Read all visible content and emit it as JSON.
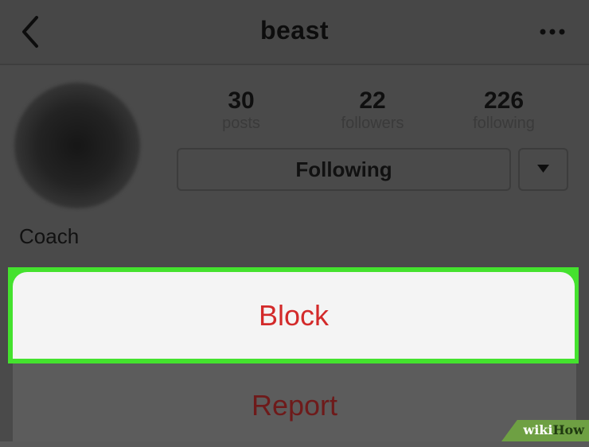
{
  "header": {
    "title": "beast",
    "back_icon": "chevron-left-icon",
    "more_icon": "more-horizontal-icon"
  },
  "profile": {
    "stats": [
      {
        "value": "30",
        "label": "posts"
      },
      {
        "value": "22",
        "label": "followers"
      },
      {
        "value": "226",
        "label": "following"
      }
    ],
    "follow_button_label": "Following",
    "dropdown_icon": "triangle-down-icon",
    "bio_name": "Coach"
  },
  "action_sheet": {
    "items": [
      {
        "label": "Block",
        "color": "#d32a2a",
        "highlighted": true
      },
      {
        "label": "Report",
        "color": "#6e1a1a"
      }
    ],
    "highlight_color": "#44e22e"
  },
  "watermark": {
    "part1": "wiki",
    "part2": "How"
  }
}
